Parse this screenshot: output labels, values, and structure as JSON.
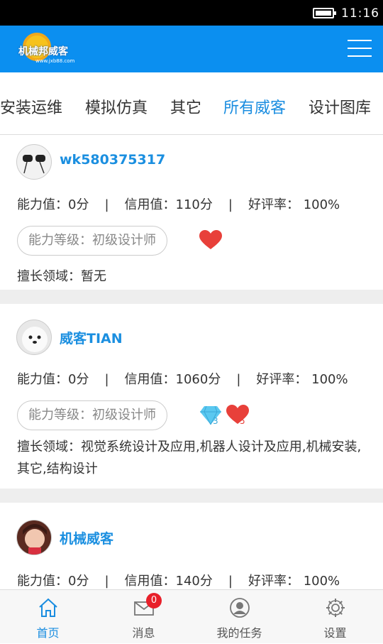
{
  "status_bar": {
    "time": "11:16"
  },
  "header": {
    "logo_text": "机械邦威客",
    "logo_url": "www.jxb88.com"
  },
  "category_tabs": [
    {
      "label": "安装运维",
      "active": false
    },
    {
      "label": "模拟仿真",
      "active": false
    },
    {
      "label": "其它",
      "active": false
    },
    {
      "label": "所有威客",
      "active": true
    },
    {
      "label": "设计图库",
      "active": false
    }
  ],
  "weikes": [
    {
      "name": "wk580375317",
      "ability": "能力值：0分",
      "credit": "信用值：110分",
      "rating": "好评率： 100%",
      "level": "能力等级：初级设计师",
      "skills": "擅长领域：暂无",
      "hearts": "",
      "diamonds": ""
    },
    {
      "name": "威客TIAN",
      "ability": "能力值：0分",
      "credit": "信用值：1060分",
      "rating": "好评率： 100%",
      "level": "能力等级：初级设计师",
      "skills": "擅长领域：视觉系统设计及应用,机器人设计及应用,机械安装,其它,结构设计",
      "hearts": "5",
      "diamonds": "3"
    },
    {
      "name": "机械威客",
      "ability": "能力值：0分",
      "credit": "信用值：140分",
      "rating": "好评率： 100%"
    }
  ],
  "bottom_nav": [
    {
      "label": "首页",
      "icon": "home-icon",
      "active": true
    },
    {
      "label": "消息",
      "icon": "mail-icon",
      "active": false,
      "badge": "0"
    },
    {
      "label": "我的任务",
      "icon": "user-icon",
      "active": false
    },
    {
      "label": "设置",
      "icon": "gear-icon",
      "active": false
    }
  ],
  "colors": {
    "header_blue": "#0b8ff0",
    "accent_blue": "#1a8de0",
    "heart_red": "#e8403a",
    "badge_red": "#e8202a"
  }
}
